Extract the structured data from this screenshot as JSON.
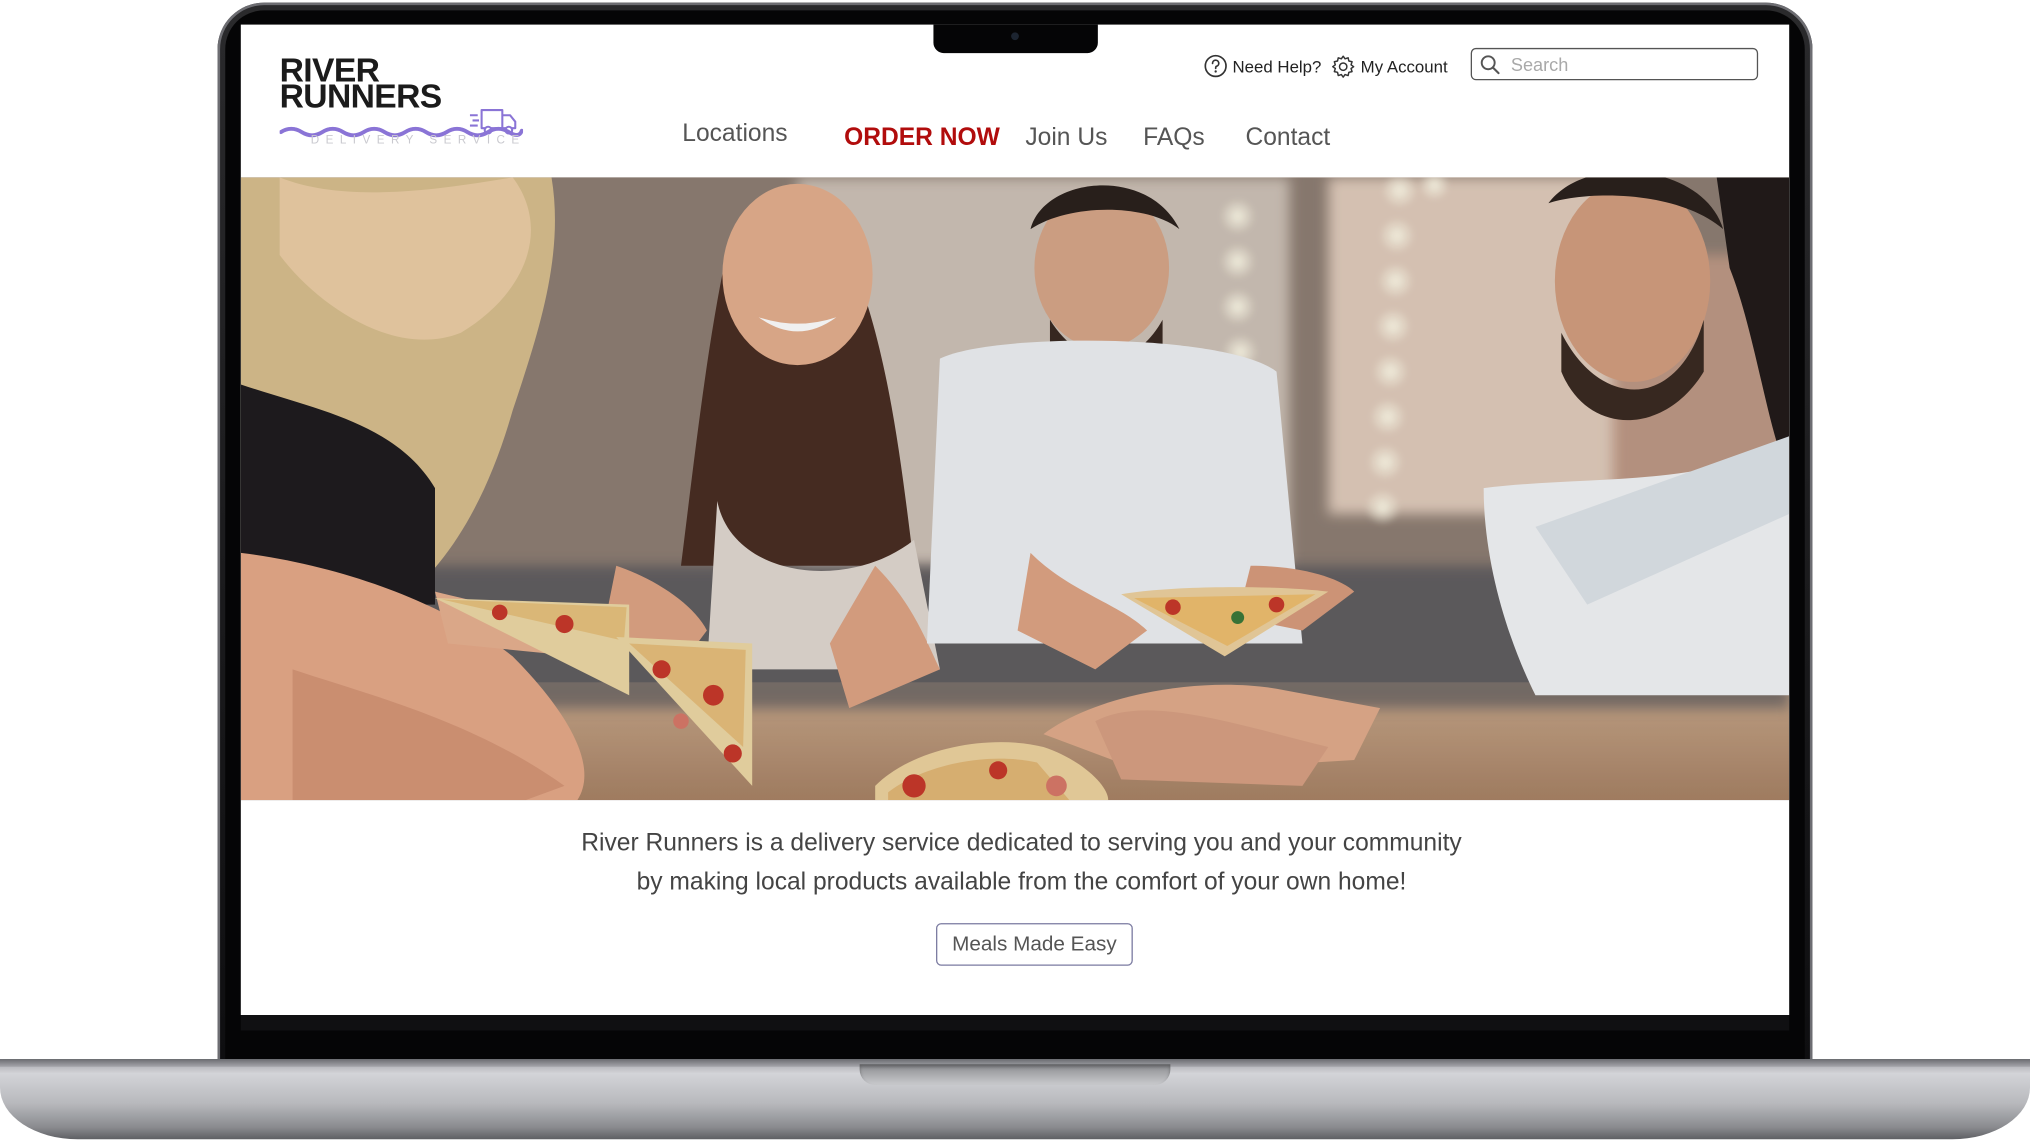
{
  "brand": {
    "name_line1": "RIVER",
    "name_line2": "RUNNERS",
    "tagline": "DELIVERY SERVICE",
    "accent_color": "#8a74d6"
  },
  "utility": {
    "help_label": "Need Help?",
    "help_icon": "question-circle-icon",
    "account_label": "My Account",
    "account_icon": "gear-icon",
    "search_placeholder": "Search",
    "search_icon": "search-icon"
  },
  "nav": {
    "items": [
      {
        "label": "Locations"
      },
      {
        "label": "ORDER NOW",
        "highlight": true,
        "color": "#b10c0c"
      },
      {
        "label": "Join Us"
      },
      {
        "label": "FAQs"
      },
      {
        "label": "Contact"
      }
    ]
  },
  "intro": {
    "line1": "River Runners is a delivery service dedicated to serving you and your community",
    "line2": "by making local products available from the comfort of your own home!"
  },
  "cta": {
    "label": "Meals Made Easy"
  }
}
